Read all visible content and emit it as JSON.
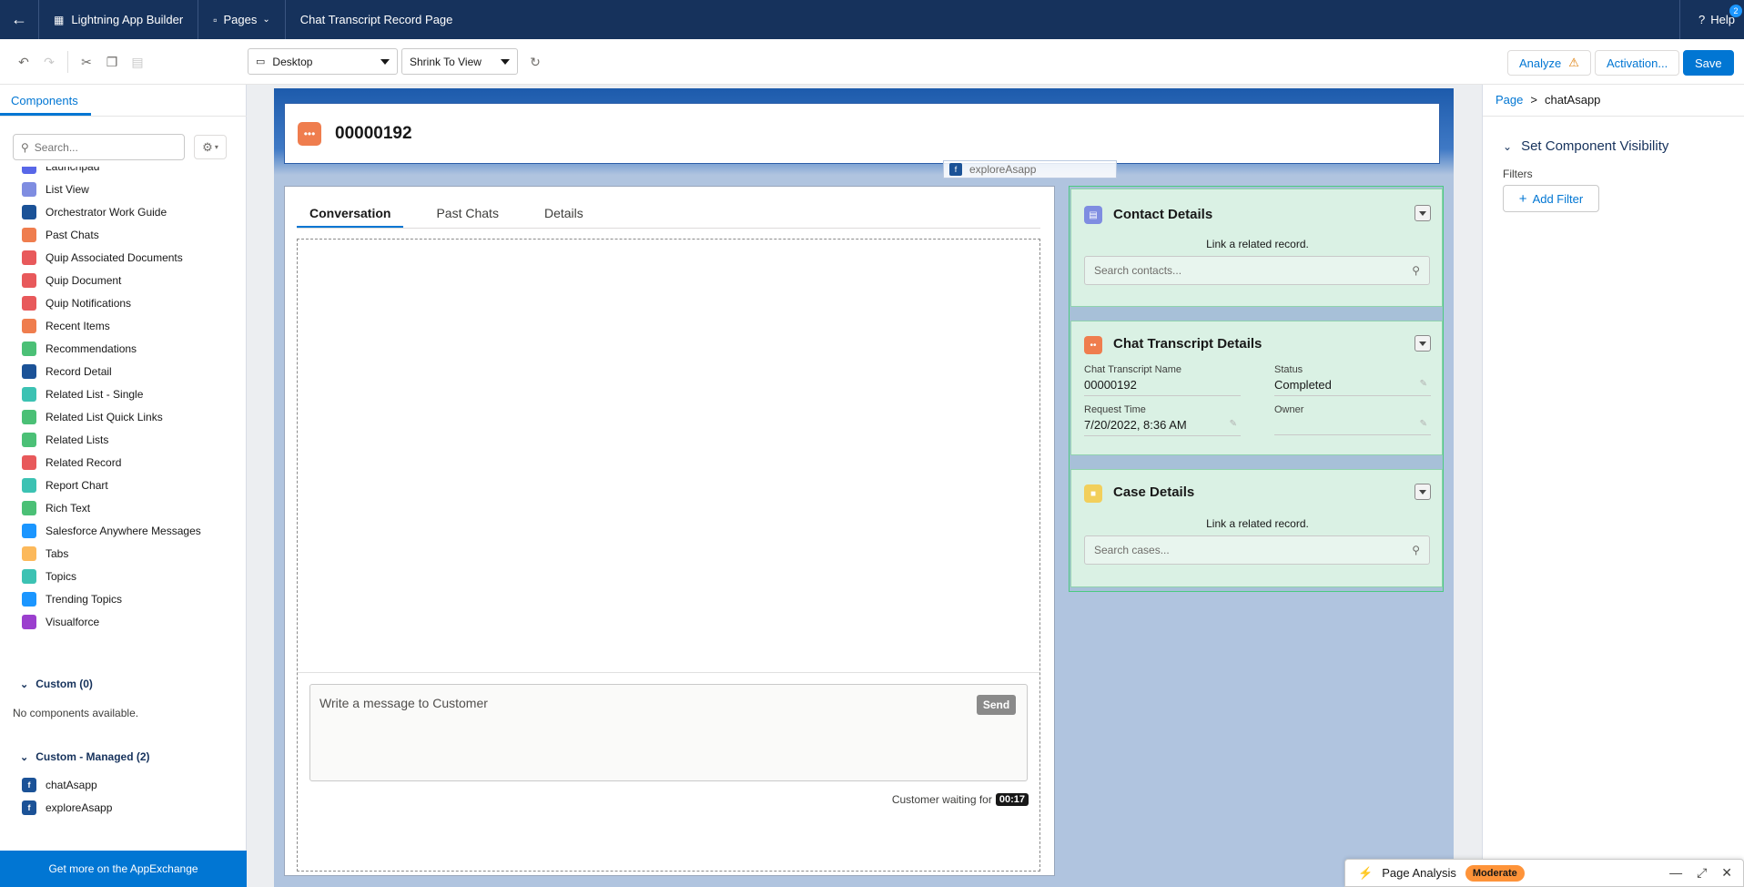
{
  "topbar": {
    "app_name": "Lightning App Builder",
    "pages_label": "Pages",
    "page_title": "Chat Transcript Record Page",
    "help_label": "Help",
    "help_badge": "2"
  },
  "toolbar": {
    "device_select": "Desktop",
    "view_select": "Shrink To View",
    "analyze_label": "Analyze",
    "activation_label": "Activation...",
    "save_label": "Save"
  },
  "left_panel": {
    "tab_label": "Components",
    "search_placeholder": "Search...",
    "components": [
      {
        "label": "Launchpad",
        "color": "#5867e8"
      },
      {
        "label": "List View",
        "color": "#7f8de1"
      },
      {
        "label": "Orchestrator Work Guide",
        "color": "#1b5297"
      },
      {
        "label": "Past Chats",
        "color": "#ef7d4e"
      },
      {
        "label": "Quip Associated Documents",
        "color": "#e8595b"
      },
      {
        "label": "Quip Document",
        "color": "#e8595b"
      },
      {
        "label": "Quip Notifications",
        "color": "#e8595b"
      },
      {
        "label": "Recent Items",
        "color": "#ef7d4e"
      },
      {
        "label": "Recommendations",
        "color": "#4bc076"
      },
      {
        "label": "Record Detail",
        "color": "#1b5297"
      },
      {
        "label": "Related List - Single",
        "color": "#3cc2b3"
      },
      {
        "label": "Related List Quick Links",
        "color": "#4bc076"
      },
      {
        "label": "Related Lists",
        "color": "#4bc076"
      },
      {
        "label": "Related Record",
        "color": "#e8595b"
      },
      {
        "label": "Report Chart",
        "color": "#3cc2b3"
      },
      {
        "label": "Rich Text",
        "color": "#4bc076"
      },
      {
        "label": "Salesforce Anywhere Messages",
        "color": "#1b96ff"
      },
      {
        "label": "Tabs",
        "color": "#fcb95b"
      },
      {
        "label": "Topics",
        "color": "#3cc2b3"
      },
      {
        "label": "Trending Topics",
        "color": "#1b96ff"
      },
      {
        "label": "Visualforce",
        "color": "#9b3fce"
      }
    ],
    "custom_header": "Custom (0)",
    "no_components": "No components available.",
    "managed_header": "Custom - Managed (2)",
    "managed": [
      {
        "label": "chatAsapp"
      },
      {
        "label": "exploreAsapp"
      }
    ],
    "appexchange_label": "Get more on the AppExchange"
  },
  "canvas": {
    "record_number": "00000192",
    "tabs": [
      {
        "label": "Conversation"
      },
      {
        "label": "Past Chats"
      },
      {
        "label": "Details"
      }
    ],
    "message_placeholder": "Write a message to Customer",
    "send_label": "Send",
    "waiting_label": "Customer waiting for",
    "waiting_time": "00:17",
    "contacts_card": {
      "title": "Contact Details",
      "link_text": "Link a related record.",
      "search_placeholder": "Search contacts..."
    },
    "drag_ghost_label": "exploreAsapp",
    "chat_details_card": {
      "title": "Chat Transcript Details",
      "fields": [
        {
          "label": "Chat Transcript Name",
          "value": "00000192"
        },
        {
          "label": "Status",
          "value": "Completed"
        },
        {
          "label": "Request Time",
          "value": "7/20/2022, 8:36 AM"
        },
        {
          "label": "Owner",
          "value": ""
        }
      ]
    },
    "case_card": {
      "title": "Case Details",
      "link_text": "Link a related record.",
      "search_placeholder": "Search cases..."
    }
  },
  "right_panel": {
    "breadcrumb_root": "Page",
    "breadcrumb_sep": ">",
    "breadcrumb_current": "chatAsapp",
    "visibility_header": "Set Component Visibility",
    "filters_label": "Filters",
    "add_filter_label": "Add Filter"
  },
  "page_analysis": {
    "label": "Page Analysis",
    "level": "Moderate"
  }
}
